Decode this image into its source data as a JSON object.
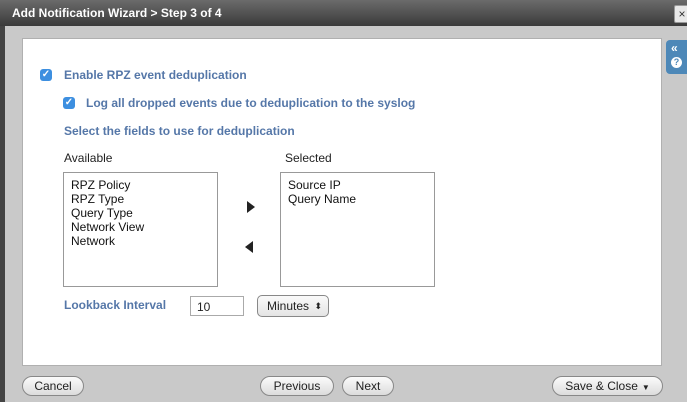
{
  "window": {
    "title": "Add Notification Wizard > Step 3 of 4",
    "close_glyph": "×"
  },
  "side": {
    "collapse_glyph": "«",
    "help_glyph": "?"
  },
  "form": {
    "enable_dedup": {
      "label": "Enable RPZ event deduplication",
      "checked": true
    },
    "log_dropped": {
      "label": "Log all dropped events due to deduplication to the syslog",
      "checked": true
    },
    "fields_heading": "Select the fields to use for deduplication",
    "available_label": "Available",
    "selected_label": "Selected",
    "available_items": [
      "RPZ Policy",
      "RPZ Type",
      "Query Type",
      "Network View",
      "Network"
    ],
    "selected_items": [
      "Source IP",
      "Query Name"
    ],
    "lookback": {
      "label": "Lookback Interval",
      "value": "10",
      "unit": "Minutes",
      "unit_caret": "⬍"
    }
  },
  "footer": {
    "cancel": "Cancel",
    "previous": "Previous",
    "next": "Next",
    "save_close": "Save & Close",
    "save_caret": "▼"
  },
  "icons": {
    "check": "✓"
  }
}
